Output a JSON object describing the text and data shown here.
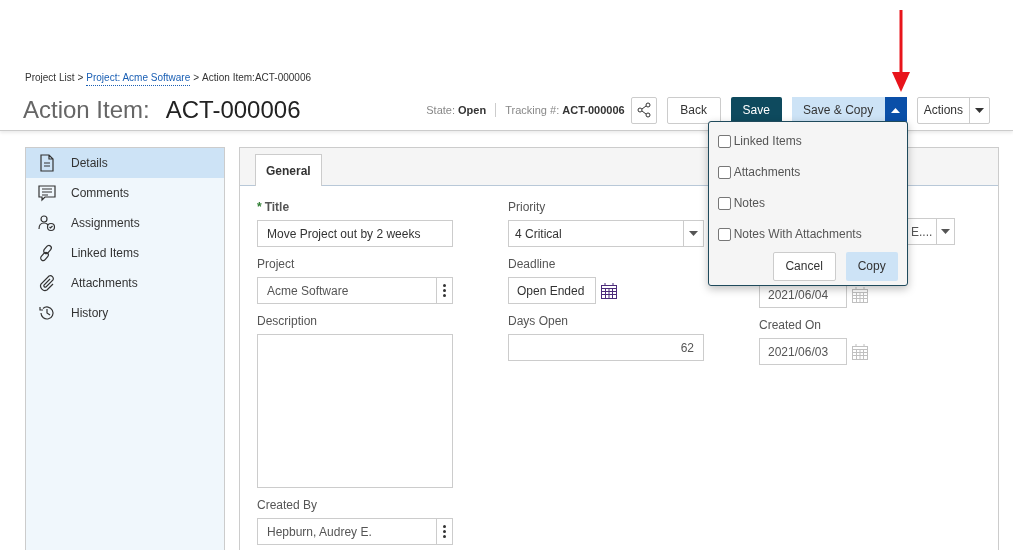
{
  "breadcrumb": [
    {
      "text": "Project List",
      "link": false
    },
    {
      "text": "Project: Acme Software",
      "link": true
    },
    {
      "text": "Action Item:ACT-000006",
      "link": false
    }
  ],
  "breadcrumb_separator": ">",
  "page_title": {
    "label": "Action Item:",
    "value": "ACT-000006"
  },
  "state": {
    "label": "State:",
    "value": "Open"
  },
  "tracking": {
    "label": "Tracking #:",
    "value": "ACT-000006"
  },
  "buttons": {
    "back": "Back",
    "save": "Save",
    "save_copy": "Save & Copy",
    "actions": "Actions"
  },
  "copy_menu": {
    "open": true,
    "options": [
      {
        "label": "Linked Items",
        "checked": false
      },
      {
        "label": "Attachments",
        "checked": false
      },
      {
        "label": "Notes",
        "checked": false
      },
      {
        "label": "Notes With Attachments",
        "checked": false
      }
    ],
    "cancel": "Cancel",
    "copy": "Copy"
  },
  "sidebar": [
    {
      "label": "Details",
      "kind": "doc",
      "selected": true
    },
    {
      "label": "Comments",
      "kind": "comment",
      "selected": false
    },
    {
      "label": "Assignments",
      "kind": "assign",
      "selected": false
    },
    {
      "label": "Linked Items",
      "kind": "link",
      "selected": false
    },
    {
      "label": "Attachments",
      "kind": "clip",
      "selected": false
    },
    {
      "label": "History",
      "kind": "history",
      "selected": false
    }
  ],
  "tabs": [
    {
      "label": "General",
      "selected": true
    }
  ],
  "form": {
    "title": {
      "label": "Title",
      "required": true,
      "required_mark": "*",
      "value": "Move Project out by 2 weeks"
    },
    "project": {
      "label": "Project",
      "value": "Acme Software"
    },
    "description": {
      "label": "Description"
    },
    "created_by": {
      "label": "Created By",
      "value": "Hepburn, Audrey E."
    },
    "priority": {
      "label": "Priority",
      "value": "4 Critical"
    },
    "deadline": {
      "label": "Deadline",
      "value": "Open Ended"
    },
    "days_open": {
      "label": "Days Open",
      "value": "62"
    },
    "column_3_select": {
      "value": "E...."
    },
    "column_3_date": {
      "value": "2021/06/04"
    },
    "created_on": {
      "label": "Created On",
      "value": "2021/06/03"
    }
  }
}
